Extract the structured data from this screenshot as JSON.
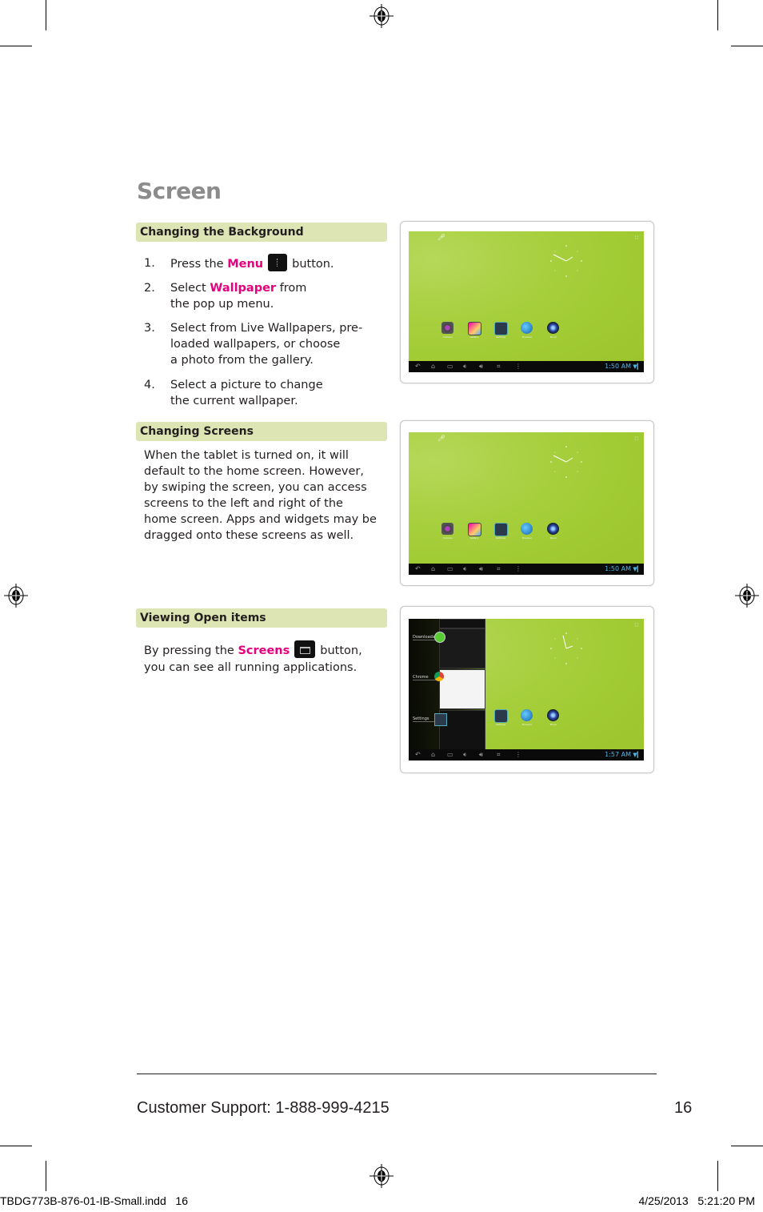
{
  "page": {
    "title": "Screen",
    "sections": [
      {
        "heading": "Changing the Background",
        "steps": [
          {
            "num": "1.",
            "pre": "Press the",
            "highlight": "Menu",
            "icon": "menu-button-icon",
            "post": "button."
          },
          {
            "num": "2.",
            "pre": "Select",
            "highlight": "Wallpaper",
            "post": "from",
            "line2": "the pop up menu."
          },
          {
            "num": "3.",
            "line1": "Select from Live Wallpapers, pre-",
            "line2": "loaded wallpapers, or choose",
            "line3": "a photo from the gallery."
          },
          {
            "num": "4.",
            "line1": "Select a picture to change",
            "line2": "the current wallpaper."
          }
        ],
        "screenshot": {
          "time": "1:50 AM",
          "apps": [
            "Camera",
            "Gallery",
            "Settings",
            "Browser",
            "Music"
          ]
        }
      },
      {
        "heading": "Changing Screens",
        "paragraph": [
          "When the tablet is turned on, it will",
          "default to the home screen. However,",
          "by swiping the screen, you can access",
          "screens to the left and right of the",
          "home screen. Apps and widgets may be",
          "dragged onto these screens as well."
        ],
        "screenshot": {
          "time": "1:50 AM",
          "apps": [
            "Camera",
            "Gallery",
            "Settings",
            "Browser",
            "Music"
          ]
        }
      },
      {
        "heading": "Viewing Open items",
        "pre": "By pressing the",
        "highlight": "Screens",
        "icon": "recent-apps-button-icon",
        "post": "button,",
        "line2": "you can see all running applications.",
        "screenshot": {
          "time": "1:57 AM",
          "recent": [
            "Downloads",
            "Chrome",
            "Settings"
          ],
          "apps": [
            "Settings",
            "Browser",
            "Music"
          ]
        }
      }
    ]
  },
  "footer": {
    "support": "Customer Support: 1-888-999-4215",
    "page_number": "16"
  },
  "slug": {
    "file": "TBDG773B-876-01-IB-Small.indd   16",
    "timestamp": "4/25/2013   5:21:20 PM"
  },
  "colors": {
    "highlight": "#e5007e",
    "section_bg": "#dde5b4",
    "title": "#8c8c8c"
  }
}
